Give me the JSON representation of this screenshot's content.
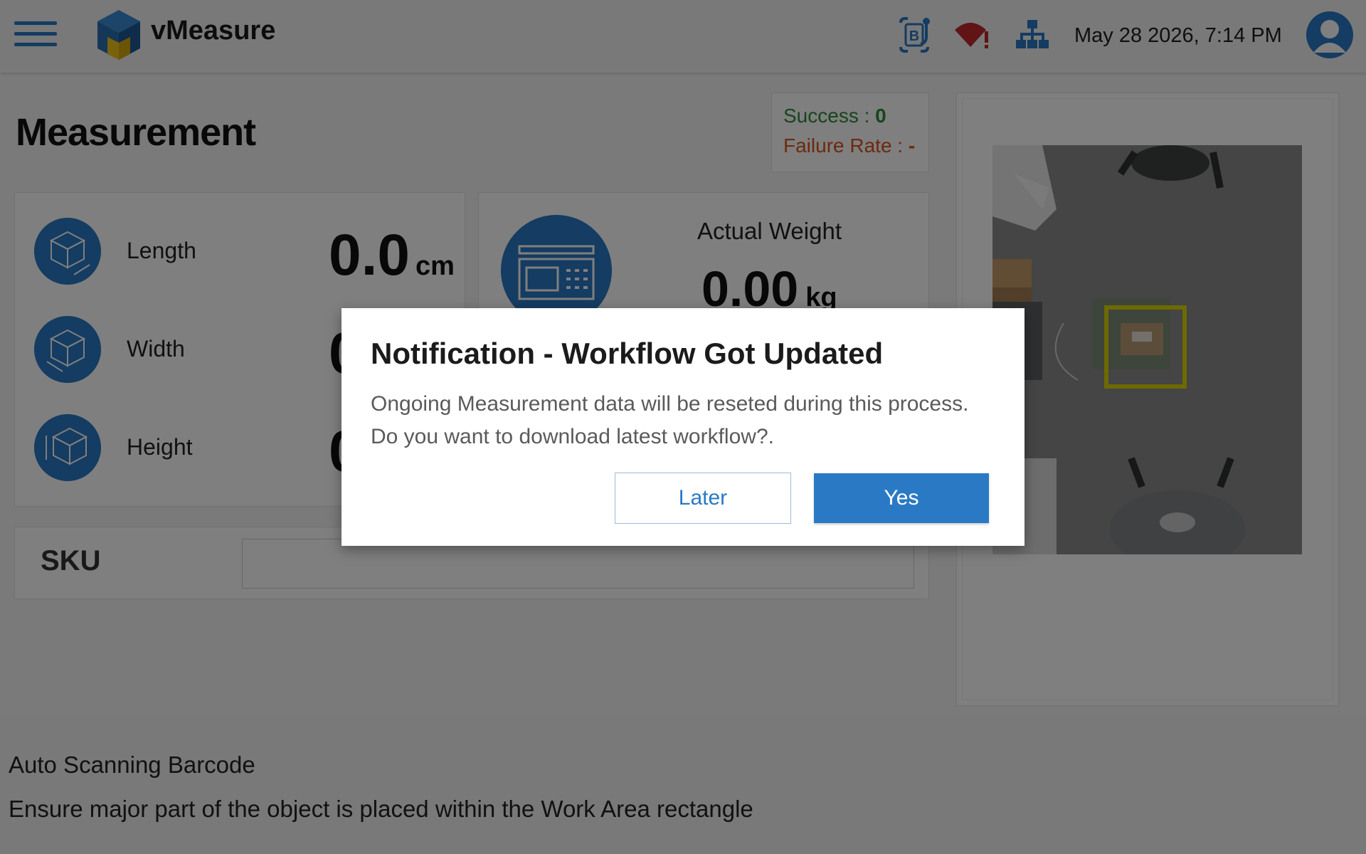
{
  "header": {
    "brand": "vMeasure",
    "datetime": "May 28 2026, 7:14 PM",
    "icons": [
      "menu-icon",
      "vmeasure-logo-icon",
      "barcode-scanner-icon",
      "wifi-alert-icon",
      "network-icon",
      "user-avatar-icon"
    ]
  },
  "main": {
    "title": "Measurement",
    "stats": {
      "success_label": "Success : ",
      "success_value": "0",
      "failure_label": "Failure Rate : ",
      "failure_value": "-"
    },
    "dimensions": [
      {
        "label": "Length",
        "value": "0.0",
        "unit": "cm"
      },
      {
        "label": "Width",
        "value": "0",
        "unit": ""
      },
      {
        "label": "Height",
        "value": "0",
        "unit": ""
      }
    ],
    "weight": {
      "label": "Actual Weight",
      "value": "0.00",
      "unit": "kg"
    },
    "sku": {
      "label": "SKU",
      "value": ""
    }
  },
  "footer": {
    "line1": "Auto Scanning Barcode",
    "line2": "Ensure major part of the object is placed within the Work Area rectangle"
  },
  "modal": {
    "title": "Notification - Workflow Got Updated",
    "body_line1": "Ongoing Measurement data will be reseted during this process.",
    "body_line2": "Do you want to download latest workflow?.",
    "later_label": "Later",
    "yes_label": "Yes"
  },
  "colors": {
    "accent": "#2a79c4",
    "success": "#2e8b3a",
    "failure": "#d9531e",
    "alert": "#c0282d",
    "work_area": "#d9d400"
  }
}
